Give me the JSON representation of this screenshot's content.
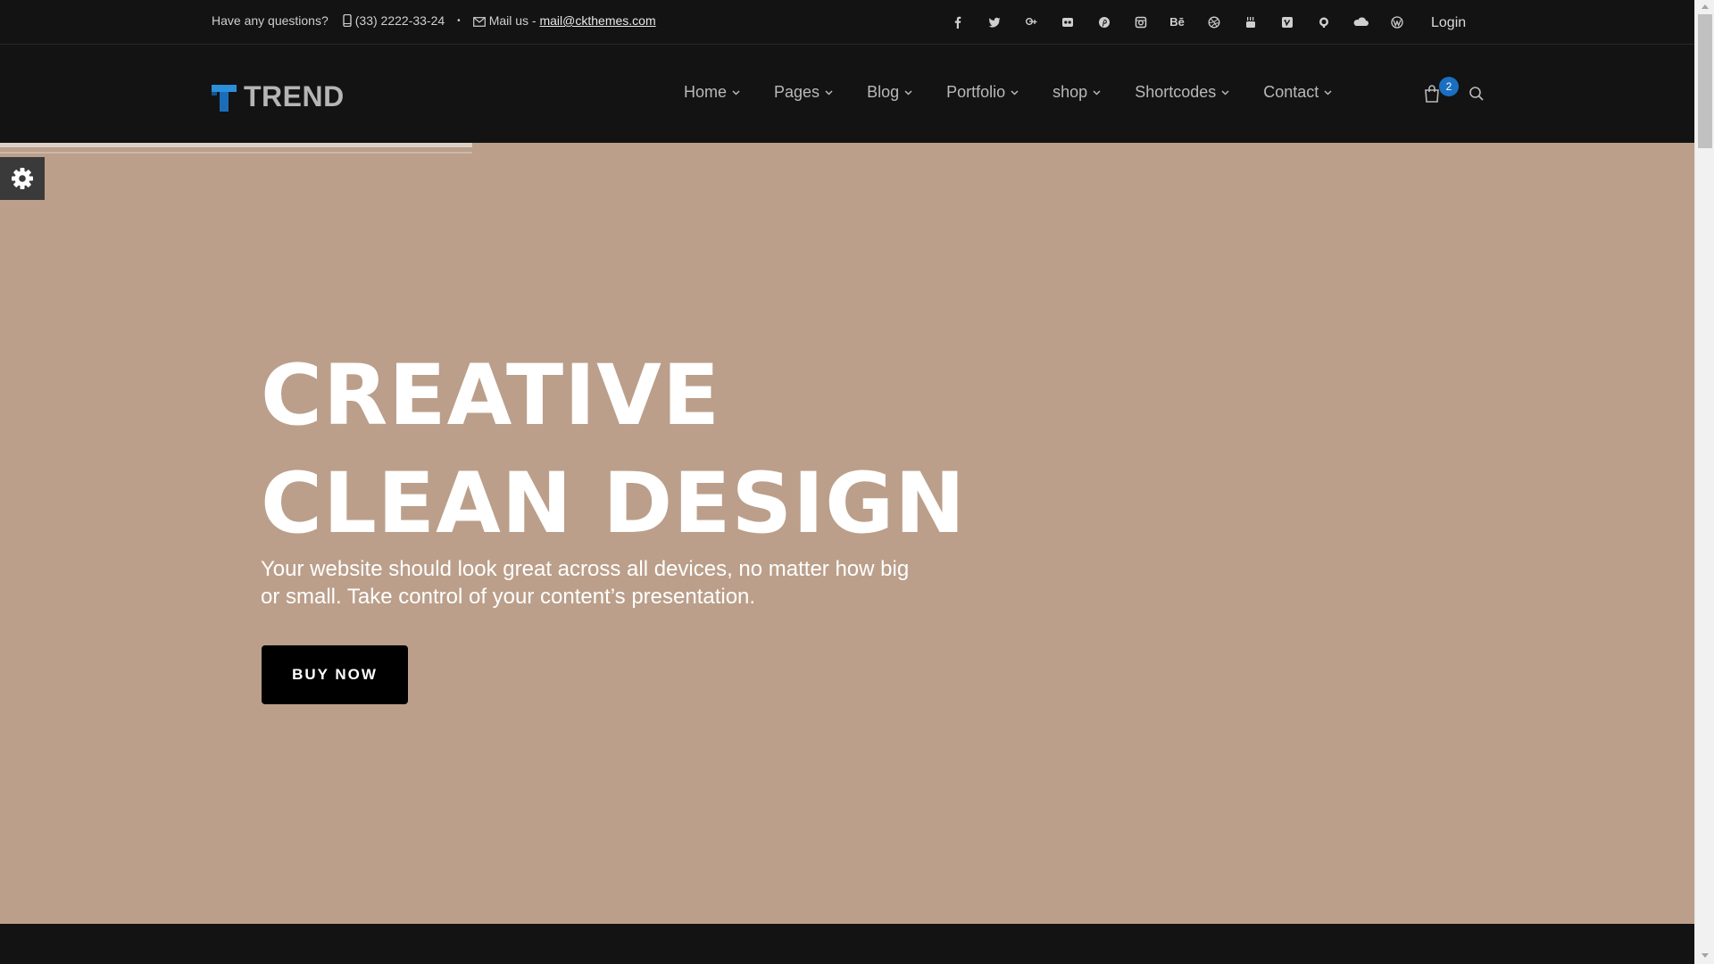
{
  "topbar": {
    "question": "Have any questions?",
    "phone": "(33) 2222-33-24",
    "dot": "•",
    "mail_label": "Mail us -",
    "email": "mail@ckthemes.com",
    "social_icons": [
      "facebook-icon",
      "twitter-icon",
      "google-plus-icon",
      "flickr-icon",
      "pinterest-icon",
      "instagram-icon",
      "behance-icon",
      "dribbble-icon",
      "youtube-icon",
      "vimeo-icon",
      "github-icon",
      "soundcloud-icon",
      "wordpress-icon"
    ],
    "behance_text": "Bē",
    "login": "Login"
  },
  "header": {
    "logo_text": "TREND",
    "nav": [
      {
        "label": "Home"
      },
      {
        "label": "Pages"
      },
      {
        "label": "Blog"
      },
      {
        "label": "Portfolio"
      },
      {
        "label": "shop"
      },
      {
        "label": "Shortcodes"
      },
      {
        "label": "Contact"
      }
    ],
    "cart_count": "2"
  },
  "hero": {
    "title_line1": "CREATIVE",
    "title_line2": "CLEAN DESIGN",
    "subtitle": "Your website should look great across all devices, no matter how big or small. Take control of your content’s presentation.",
    "button": "BUY NOW"
  },
  "colors": {
    "hero_bg": "#bb9f8a",
    "header_bg": "#131313",
    "badge": "#1b6fc1",
    "logo_accent": "#2b8fd9"
  }
}
